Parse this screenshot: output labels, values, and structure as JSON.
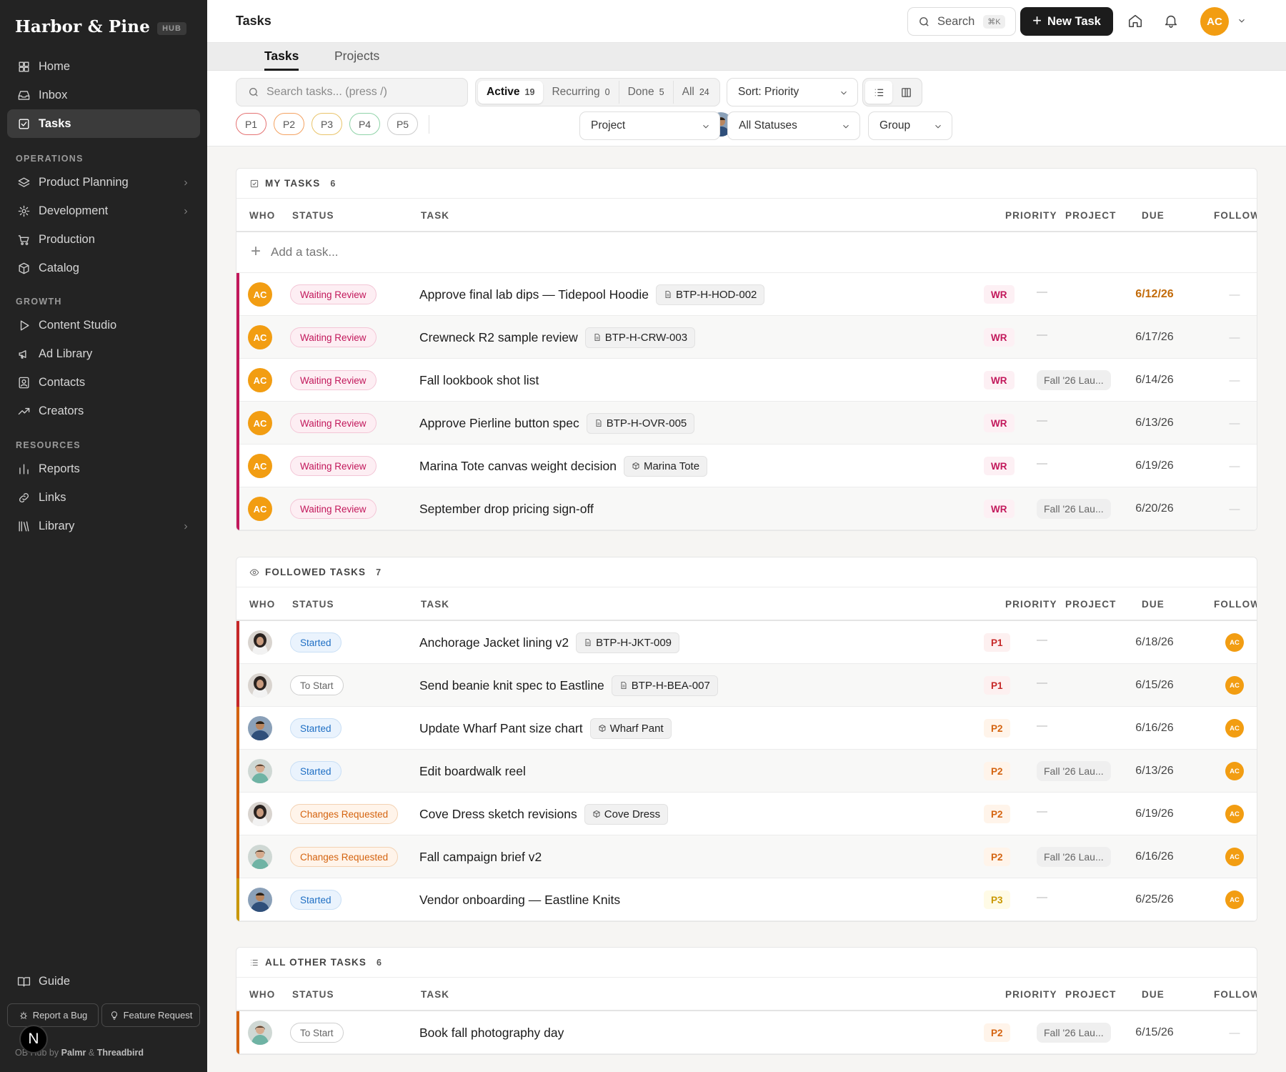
{
  "brand": {
    "name": "Harbor & Pine",
    "badge": "HUB"
  },
  "sidebar": {
    "top_items": [
      {
        "label": "Home",
        "icon": "grid-icon"
      },
      {
        "label": "Inbox",
        "icon": "inbox-icon"
      },
      {
        "label": "Tasks",
        "icon": "checkbox-icon",
        "active": true
      }
    ],
    "sections": [
      {
        "title": "OPERATIONS",
        "items": [
          {
            "label": "Product Planning",
            "icon": "layers-icon",
            "chevron": true
          },
          {
            "label": "Development",
            "icon": "gear-icon",
            "chevron": true
          },
          {
            "label": "Production",
            "icon": "cart-icon"
          },
          {
            "label": "Catalog",
            "icon": "box-icon"
          }
        ]
      },
      {
        "title": "GROWTH",
        "items": [
          {
            "label": "Content Studio",
            "icon": "play-icon"
          },
          {
            "label": "Ad Library",
            "icon": "megaphone-icon"
          },
          {
            "label": "Contacts",
            "icon": "contact-card-icon"
          },
          {
            "label": "Creators",
            "icon": "trend-icon"
          }
        ]
      },
      {
        "title": "RESOURCES",
        "items": [
          {
            "label": "Reports",
            "icon": "bar-chart-icon"
          },
          {
            "label": "Links",
            "icon": "link-icon"
          },
          {
            "label": "Library",
            "icon": "books-icon",
            "chevron": true
          }
        ]
      }
    ],
    "guide": "Guide",
    "report_bug": "Report a Bug",
    "feature_request": "Feature Request",
    "credit_prefix": "OB Hub by",
    "credit_a": "Palmr",
    "credit_amp": "&",
    "credit_b": "Threadbird",
    "n_badge": "N"
  },
  "topbar": {
    "title": "Tasks",
    "search_label": "Search",
    "search_kbd": "⌘K",
    "new_task": "New Task",
    "avatar": "AC"
  },
  "tabs": [
    "Tasks",
    "Projects"
  ],
  "filters": {
    "search_placeholder": "Search tasks... (press /)",
    "segments": [
      {
        "label": "Active",
        "count": "19",
        "active": true
      },
      {
        "label": "Recurring",
        "count": "0"
      },
      {
        "label": "Done",
        "count": "5"
      },
      {
        "label": "All",
        "count": "24"
      }
    ],
    "sort": "Sort: Priority",
    "project": "Project",
    "statuses": "All Statuses",
    "group": "Group",
    "priorities": [
      "P1",
      "P2",
      "P3",
      "P4",
      "P5"
    ],
    "priority_colors": [
      "#e57373",
      "#f4a261",
      "#e9c46a",
      "#8fd3a8",
      "#cccccc"
    ],
    "people_first": "AC"
  },
  "columns": {
    "who": "WHO",
    "status": "STATUS",
    "task": "TASK",
    "priority": "PRIORITY",
    "project": "PROJECT",
    "due": "DUE",
    "follow": "FOLLOW"
  },
  "add_task": "Add a task...",
  "sections": [
    {
      "title": "MY TASKS",
      "count": "6",
      "icon": "checkbox-icon",
      "rows": [
        {
          "who": "AC",
          "status": "Waiting Review",
          "st": "wr",
          "task": "Approve final lab dips — Tidepool Hoodie",
          "tag": "BTP-H-HOD-002",
          "tagicon": "doc",
          "prio": "WR",
          "pr": "wr",
          "project": "—",
          "due": "6/12/26",
          "soon": true,
          "follow": "—",
          "bar": "#c2185b"
        },
        {
          "who": "AC",
          "status": "Waiting Review",
          "st": "wr",
          "task": "Crewneck R2 sample review",
          "tag": "BTP-H-CRW-003",
          "tagicon": "doc",
          "prio": "WR",
          "pr": "wr",
          "project": "—",
          "due": "6/17/26",
          "follow": "—",
          "bar": "#c2185b"
        },
        {
          "who": "AC",
          "status": "Waiting Review",
          "st": "wr",
          "task": "Fall lookbook shot list",
          "prio": "WR",
          "pr": "wr",
          "project": "Fall '26 Lau...",
          "due": "6/14/26",
          "follow": "—",
          "bar": "#c2185b"
        },
        {
          "who": "AC",
          "status": "Waiting Review",
          "st": "wr",
          "task": "Approve Pierline button spec",
          "tag": "BTP-H-OVR-005",
          "tagicon": "doc",
          "prio": "WR",
          "pr": "wr",
          "project": "—",
          "due": "6/13/26",
          "follow": "—",
          "bar": "#c2185b"
        },
        {
          "who": "AC",
          "status": "Waiting Review",
          "st": "wr",
          "task": "Marina Tote canvas weight decision",
          "tag": "Marina Tote",
          "tagicon": "box",
          "prio": "WR",
          "pr": "wr",
          "project": "—",
          "due": "6/19/26",
          "follow": "—",
          "bar": "#c2185b"
        },
        {
          "who": "AC",
          "status": "Waiting Review",
          "st": "wr",
          "task": "September drop pricing sign-off",
          "prio": "WR",
          "pr": "wr",
          "project": "Fall '26 Lau...",
          "due": "6/20/26",
          "follow": "—",
          "bar": "#c2185b"
        }
      ]
    },
    {
      "title": "FOLLOWED TASKS",
      "count": "7",
      "icon": "eye-icon",
      "rows": [
        {
          "who": "p1",
          "status": "Started",
          "st": "started",
          "task": "Anchorage Jacket lining v2",
          "tag": "BTP-H-JKT-009",
          "tagicon": "doc",
          "prio": "P1",
          "pr": "p1",
          "project": "—",
          "due": "6/18/26",
          "follow": "AC",
          "bar": "#c62828"
        },
        {
          "who": "p1",
          "status": "To Start",
          "st": "tostart",
          "task": "Send beanie knit spec to Eastline",
          "tag": "BTP-H-BEA-007",
          "tagicon": "doc",
          "prio": "P1",
          "pr": "p1",
          "project": "—",
          "due": "6/15/26",
          "follow": "AC",
          "bar": "#c62828"
        },
        {
          "who": "p2",
          "status": "Started",
          "st": "started",
          "task": "Update Wharf Pant size chart",
          "tag": "Wharf Pant",
          "tagicon": "box",
          "prio": "P2",
          "pr": "p2",
          "project": "—",
          "due": "6/16/26",
          "follow": "AC",
          "bar": "#d4630f"
        },
        {
          "who": "p3",
          "status": "Started",
          "st": "started",
          "task": "Edit boardwalk reel",
          "prio": "P2",
          "pr": "p2",
          "project": "Fall '26 Lau...",
          "due": "6/13/26",
          "follow": "AC",
          "bar": "#d4630f"
        },
        {
          "who": "p1",
          "status": "Changes Requested",
          "st": "cr",
          "task": "Cove Dress sketch revisions",
          "tag": "Cove Dress",
          "tagicon": "box",
          "prio": "P2",
          "pr": "p2",
          "project": "—",
          "due": "6/19/26",
          "follow": "AC",
          "bar": "#d4630f"
        },
        {
          "who": "p3",
          "status": "Changes Requested",
          "st": "cr",
          "task": "Fall campaign brief v2",
          "prio": "P2",
          "pr": "p2",
          "project": "Fall '26 Lau...",
          "due": "6/16/26",
          "follow": "AC",
          "bar": "#d4630f"
        },
        {
          "who": "p2",
          "status": "Started",
          "st": "started",
          "task": "Vendor onboarding — Eastline Knits",
          "prio": "P3",
          "pr": "p3",
          "project": "—",
          "due": "6/25/26",
          "follow": "AC",
          "bar": "#c99700"
        }
      ]
    },
    {
      "title": "ALL OTHER TASKS",
      "count": "6",
      "icon": "list-icon",
      "rows": [
        {
          "who": "p3",
          "status": "To Start",
          "st": "tostart",
          "task": "Book fall photography day",
          "prio": "P2",
          "pr": "p2",
          "project": "Fall '26 Lau...",
          "due": "6/15/26",
          "follow": "—",
          "bar": "#d4630f"
        }
      ]
    }
  ]
}
